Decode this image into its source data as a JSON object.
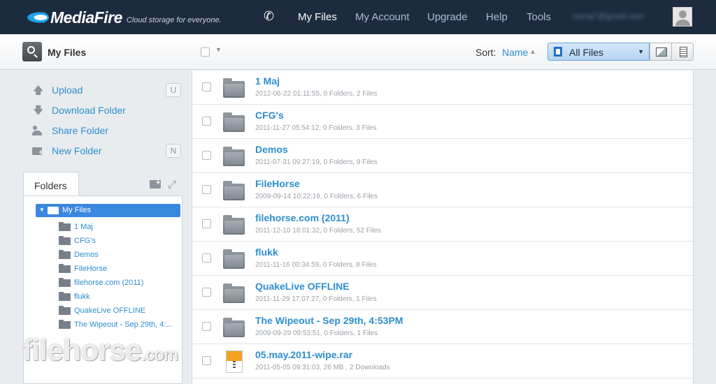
{
  "header": {
    "logo_text": "MediaFire",
    "tagline": "Cloud storage for everyone.",
    "nav": [
      "My Files",
      "My Account",
      "Upgrade",
      "Help",
      "Tools"
    ],
    "active_nav": "My Files",
    "email": "zorraj7@gmail.com"
  },
  "toolbar": {
    "title": "My Files",
    "sort_label": "Sort:",
    "sort_value": "Name",
    "filter_value": "All Files"
  },
  "sidebar": {
    "actions": [
      {
        "label": "Upload",
        "icon": "upload-arrow-icon",
        "shortcut": "U"
      },
      {
        "label": "Download Folder",
        "icon": "download-arrow-icon",
        "shortcut": ""
      },
      {
        "label": "Share Folder",
        "icon": "share-users-icon",
        "shortcut": ""
      },
      {
        "label": "New Folder",
        "icon": "new-folder-icon",
        "shortcut": "N"
      }
    ],
    "folders_tab": "Folders",
    "tree_root": "My Files",
    "tree_items": [
      "1 Maj",
      "CFG's",
      "Demos",
      "FileHorse",
      "filehorse.com (2011)",
      "flukk",
      "QuakeLive OFFLINE",
      "The Wipeout - Sep 29th, 4:..."
    ]
  },
  "files": [
    {
      "name": "1 Maj",
      "meta": "2012-06-22 01:11:55, 0 Folders, 2 Files",
      "type": "folder"
    },
    {
      "name": "CFG's",
      "meta": "2011-11-27 05:54:12, 0 Folders, 3 Files",
      "type": "folder"
    },
    {
      "name": "Demos",
      "meta": "2011-07-31 09:27:19, 0 Folders, 9 Files",
      "type": "folder"
    },
    {
      "name": "FileHorse",
      "meta": "2009-09-14 10:22:19, 0 Folders, 6 Files",
      "type": "folder"
    },
    {
      "name": "filehorse.com (2011)",
      "meta": "2011-12-10 18:01:32, 0 Folders, 52 Files",
      "type": "folder"
    },
    {
      "name": "flukk",
      "meta": "2011-11-16 00:34:59, 0 Folders, 8 Files",
      "type": "folder"
    },
    {
      "name": "QuakeLive OFFLINE",
      "meta": "2011-11-29 17:07:27, 0 Folders, 1 Files",
      "type": "folder"
    },
    {
      "name": "The Wipeout - Sep 29th, 4:53PM",
      "meta": "2009-09-29 09:53:51, 0 Folders, 1 Files",
      "type": "folder"
    },
    {
      "name": "05.may.2011-wipe.rar",
      "meta": "2011-05-05 09:31:03, 26 MB , 2 Downloads",
      "type": "rar"
    }
  ],
  "watermark": {
    "main": "filehorse",
    "suffix": ".com"
  },
  "colors": {
    "header_bg": "#1d2b3e",
    "link": "#2d8ecf",
    "selected": "#3a87e0"
  }
}
